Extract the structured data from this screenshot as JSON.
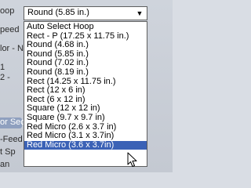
{
  "background": {
    "fragments": [
      "oop",
      "peed",
      "lor - N",
      "1",
      "2 -",
      "or Sec",
      "-Feed",
      "t Sp",
      "an"
    ]
  },
  "hoop_select": {
    "value": "Round (5.85 in.)",
    "arrow_icon": "chevron-down-icon",
    "options": [
      "Auto Select Hoop",
      "Rect - P (17.25 x 11.75 in.)",
      "Round (4.68 in.)",
      "Round (5.85 in.)",
      "Round (7.02 in.)",
      "Round (8.19 in.)",
      "Rect (14.25 x 11.75 in.)",
      "Rect (12 x 6 in)",
      "Rect (6 x 12 in)",
      "Square (12 x 12 in)",
      "Square (9.7 x 9.7 in)",
      "Red Micro (2.6 x 3.7 in)",
      "Red Micro (3.1 x 3.7in)",
      "Red Micro (3.6 x 3.7in)"
    ],
    "highlighted_index": 13
  },
  "colors": {
    "highlight": "#3b62b6",
    "border": "#5e5e5e"
  }
}
